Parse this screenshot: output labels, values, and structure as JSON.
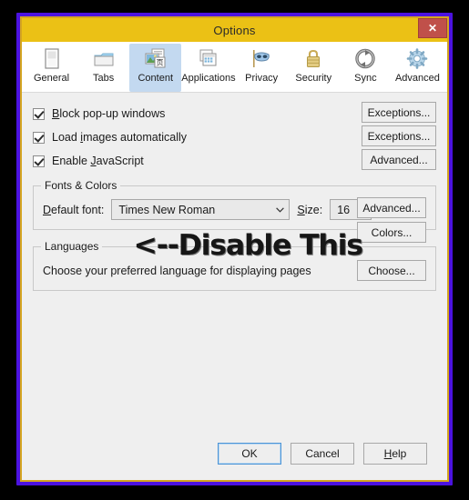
{
  "window": {
    "title": "Options",
    "close_label": "✕"
  },
  "toolbar": {
    "items": [
      {
        "label": "General",
        "icon": "general-icon",
        "selected": false
      },
      {
        "label": "Tabs",
        "icon": "tabs-folder-icon",
        "selected": false
      },
      {
        "label": "Content",
        "icon": "content-pages-icon",
        "selected": true
      },
      {
        "label": "Applications",
        "icon": "applications-icon",
        "selected": false
      },
      {
        "label": "Privacy",
        "icon": "privacy-mask-icon",
        "selected": false
      },
      {
        "label": "Security",
        "icon": "security-lock-icon",
        "selected": false
      },
      {
        "label": "Sync",
        "icon": "sync-arrows-icon",
        "selected": false
      },
      {
        "label": "Advanced",
        "icon": "advanced-gear-icon",
        "selected": false
      }
    ]
  },
  "content": {
    "checkboxes": [
      {
        "label_pre": "",
        "label_acc": "B",
        "label_post": "lock pop-up windows",
        "checked": true
      },
      {
        "label_pre": "Load ",
        "label_acc": "i",
        "label_post": "mages automatically",
        "checked": true
      },
      {
        "label_pre": "Enable ",
        "label_acc": "J",
        "label_post": "avaScript",
        "checked": true
      }
    ],
    "right_buttons": [
      {
        "label": "Exceptions...",
        "acc": "E"
      },
      {
        "label": "Exceptions...",
        "acc": "x"
      },
      {
        "label": "Advanced...",
        "acc": "v"
      }
    ],
    "annotation": "<--Disable This"
  },
  "fonts_colors": {
    "group_title": "Fonts & Colors",
    "default_font_label": "Default font:",
    "default_font_value": "Times New Roman",
    "size_label": "Size:",
    "size_value": "16",
    "advanced_button": "Advanced...",
    "colors_button": "Colors...",
    "chevron": "⌄"
  },
  "languages": {
    "group_title": "Languages",
    "description": "Choose your preferred language for displaying pages",
    "choose_button": "Choose..."
  },
  "footer": {
    "ok_label": "OK",
    "cancel_label": "Cancel",
    "help_label": "Help"
  },
  "colors": {
    "titlebar": "#ebc115",
    "border_outer": "#4b12e0",
    "border_inner": "#d4a520",
    "panel_bg": "#efefef",
    "tab_selected": "#c3d9f0",
    "close_button": "#c0504a"
  }
}
